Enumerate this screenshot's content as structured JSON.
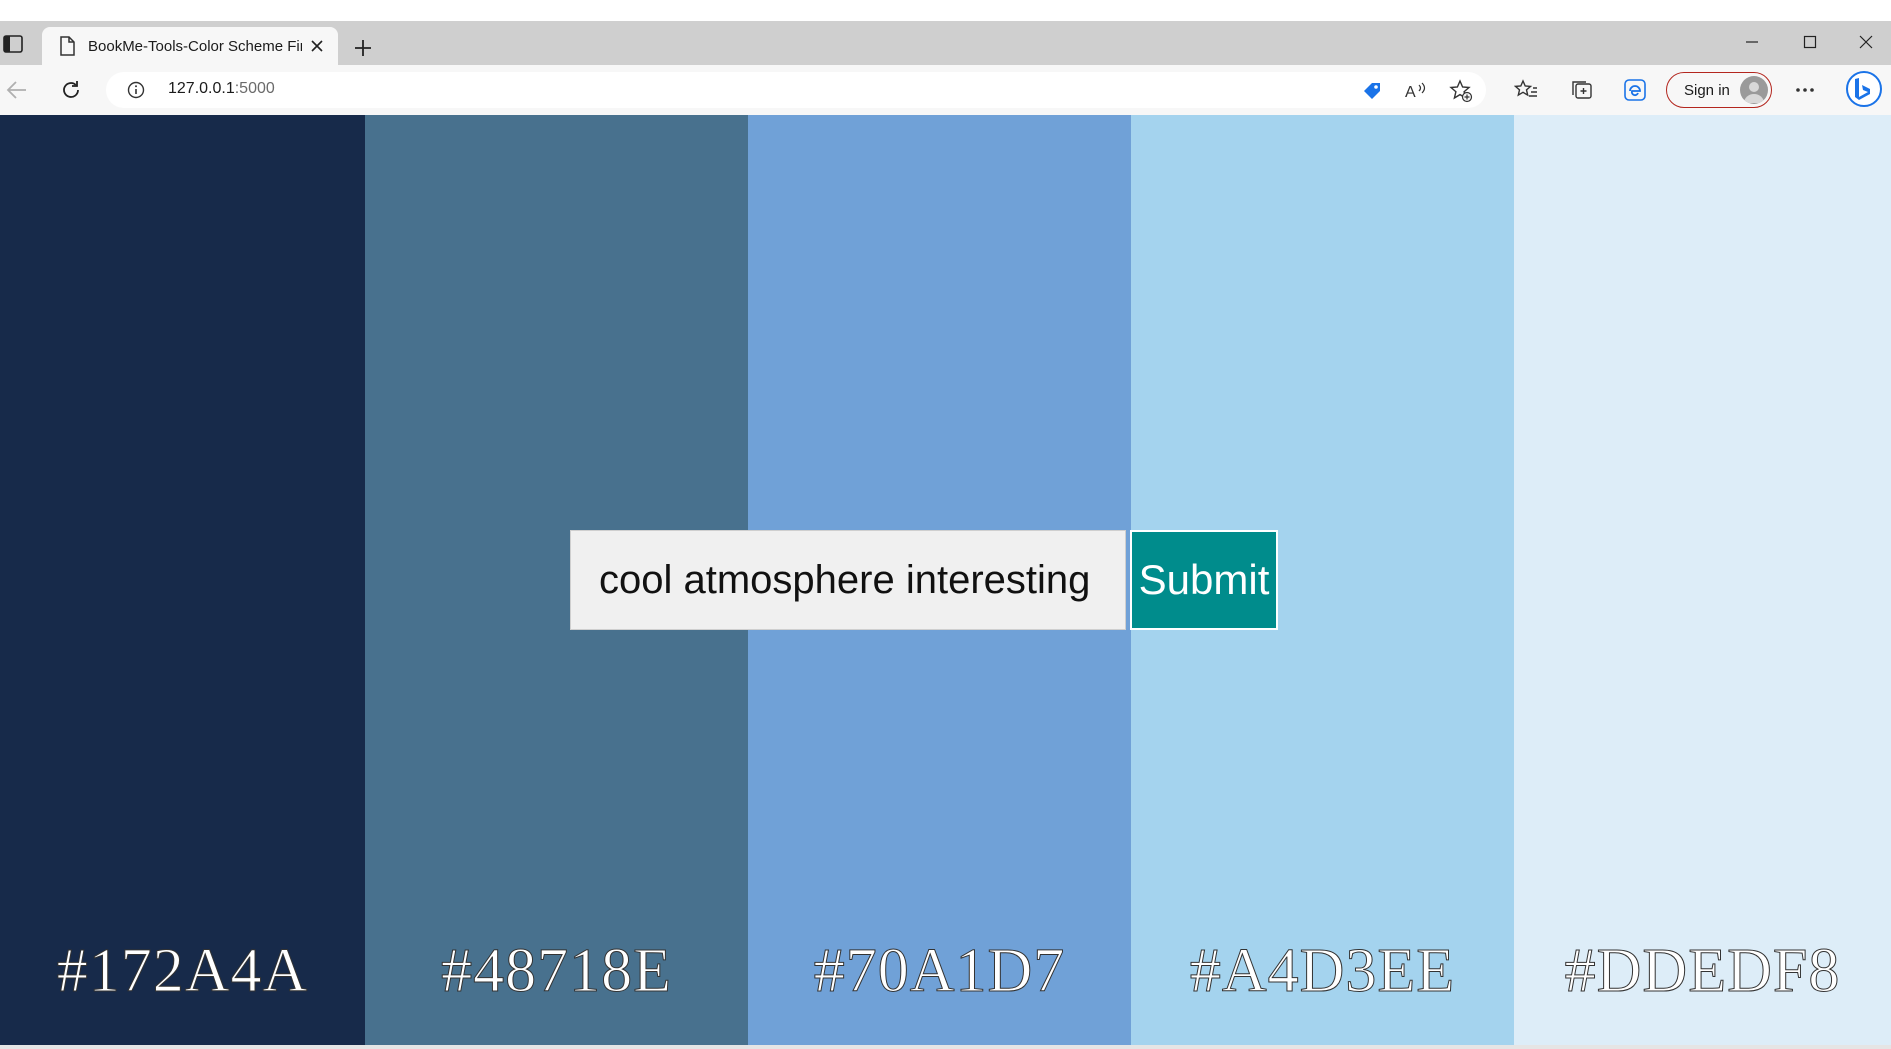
{
  "browser": {
    "tab_title": "BookMe-Tools-Color Scheme Finder",
    "url_host": "127.0.0.1",
    "url_port": ":5000",
    "sign_in_label": "Sign in",
    "icons": [
      "sidebar-toggle-icon",
      "page-icon",
      "close-icon",
      "plus-icon",
      "minimize-icon",
      "maximize-icon",
      "window-close-icon",
      "back-arrow-icon",
      "refresh-icon",
      "info-icon",
      "tag-icon",
      "read-aloud-icon",
      "add-favorite-icon",
      "favorites-icon",
      "collections-icon",
      "edge-browser-essentials-icon",
      "more-icon",
      "bing-icon"
    ]
  },
  "palette": {
    "colors": [
      {
        "hex": "#172A4A",
        "label": "#172A4A"
      },
      {
        "hex": "#48718E",
        "label": "#48718E"
      },
      {
        "hex": "#70A1D7",
        "label": "#70A1D7"
      },
      {
        "hex": "#A4D3EE",
        "label": "#A4D3EE"
      },
      {
        "hex": "#DDEDF8",
        "label": "#DDEDF8"
      }
    ]
  },
  "form": {
    "query_value": "cool atmosphere interesting",
    "submit_label": "Submit",
    "submit_color": "#008C8C"
  }
}
